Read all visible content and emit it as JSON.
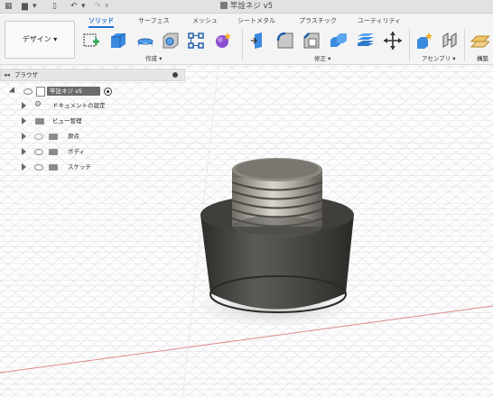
{
  "document_title": "竿詮ネジ v5",
  "workspace_button": "デザイン ▾",
  "tabs": [
    "ソリッド",
    "サーフェス",
    "メッシュ",
    "シートメタル",
    "プラスチック",
    "ユーティリティ"
  ],
  "active_tab": "ソリッド",
  "groups": {
    "create": "作成 ▾",
    "modify": "修正 ▾",
    "assemble": "アセンブリ ▾",
    "construct": "構築"
  },
  "browser": {
    "title": "ブラウザ",
    "root": "竿詮ネジ v5",
    "items": [
      "ドキュメントの設定",
      "ビュー管理",
      "原点",
      "ボディ",
      "スケッチ"
    ]
  },
  "colors": {
    "accent": "#1e6fd1",
    "model_body": "#4d4c48",
    "axis_red": "#d96a6a",
    "grid": "#d9dde3"
  }
}
